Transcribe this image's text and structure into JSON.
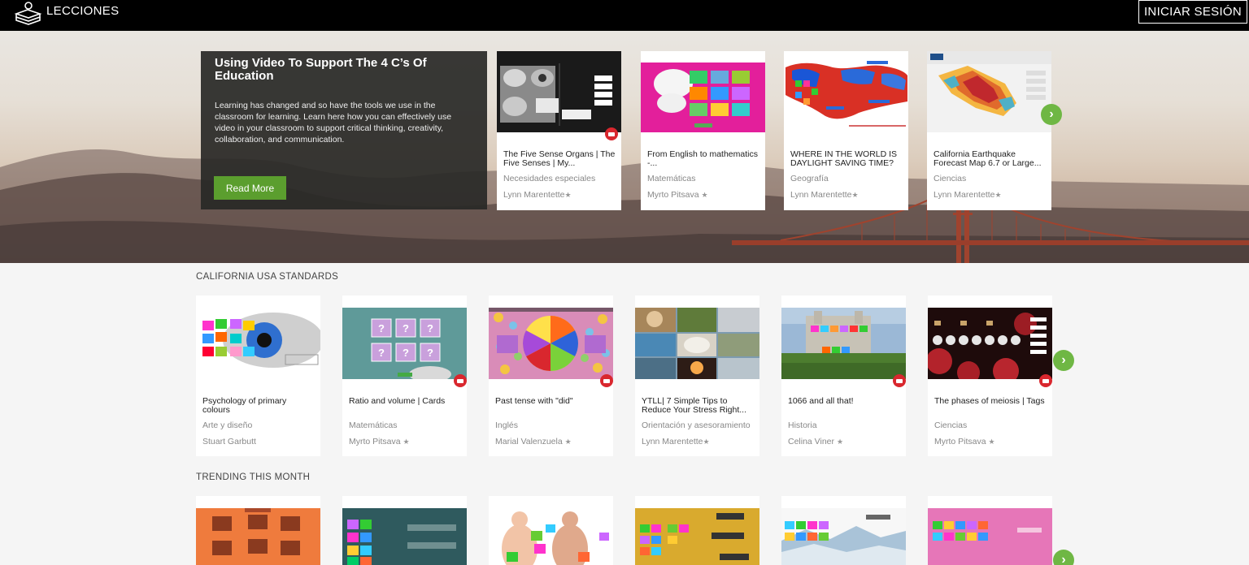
{
  "header": {
    "brand": "LECCIONES",
    "login_label": "INICIAR SESIÓN"
  },
  "hero": {
    "feature_title": "Using Video To Support The 4 C’s Of Education",
    "feature_text": "Learning has changed and so have the tools we use in the classroom for learning. Learn here how you can effectively use video in your classroom to support critical thinking, creativity, collaboration, and communication.",
    "read_more_label": "Read More",
    "cards": [
      {
        "title": "The Five Sense Organs | The Five Senses | My...",
        "subject": "Necesidades especiales",
        "author": "Lynn Marentette",
        "star": "★"
      },
      {
        "title": "From English to mathematics -...",
        "subject": "Matemáticas",
        "author": "Myrto Pitsava",
        "star": "★"
      },
      {
        "title": "WHERE IN THE WORLD IS DAYLIGHT SAVING TIME?",
        "subject": "Geografía",
        "author": "Lynn Marentette",
        "star": "★"
      },
      {
        "title": "California Earthquake Forecast Map 6.7 or Large...",
        "subject": "Ciencias",
        "author": "Lynn Marentette",
        "star": "★"
      }
    ]
  },
  "sections": {
    "california_title": "CALIFORNIA USA STANDARDS",
    "trending_title": "TRENDING THIS MONTH",
    "california_cards": [
      {
        "title": "Psychology of primary colours",
        "subject": "Arte y diseño",
        "author": "Stuart Garbutt",
        "star": ""
      },
      {
        "title": "Ratio and volume | Cards",
        "subject": "Matemáticas",
        "author": "Myrto Pitsava",
        "star": "★"
      },
      {
        "title": "Past tense with \"did\"",
        "subject": "Inglés",
        "author": "Marial Valenzuela",
        "star": "★"
      },
      {
        "title": "YTLL| 7 Simple Tips to Reduce Your Stress Right...",
        "subject": "Orientación y asesoramiento",
        "author": "Lynn Marentette",
        "star": "★"
      },
      {
        "title": "1066 and all that!",
        "subject": "Historia",
        "author": "Celina Viner",
        "star": "★"
      },
      {
        "title": "The phases of meiosis | Tags",
        "subject": "Ciencias",
        "author": "Myrto Pitsava",
        "star": "★"
      }
    ]
  },
  "icons": {
    "logo": "books-stack-icon",
    "video": "youtube-icon",
    "next": "chevron-right-icon"
  },
  "colors": {
    "accent_green": "#5b9e2e",
    "arrow_green": "#6fb744",
    "youtube_red": "#d9272e"
  }
}
